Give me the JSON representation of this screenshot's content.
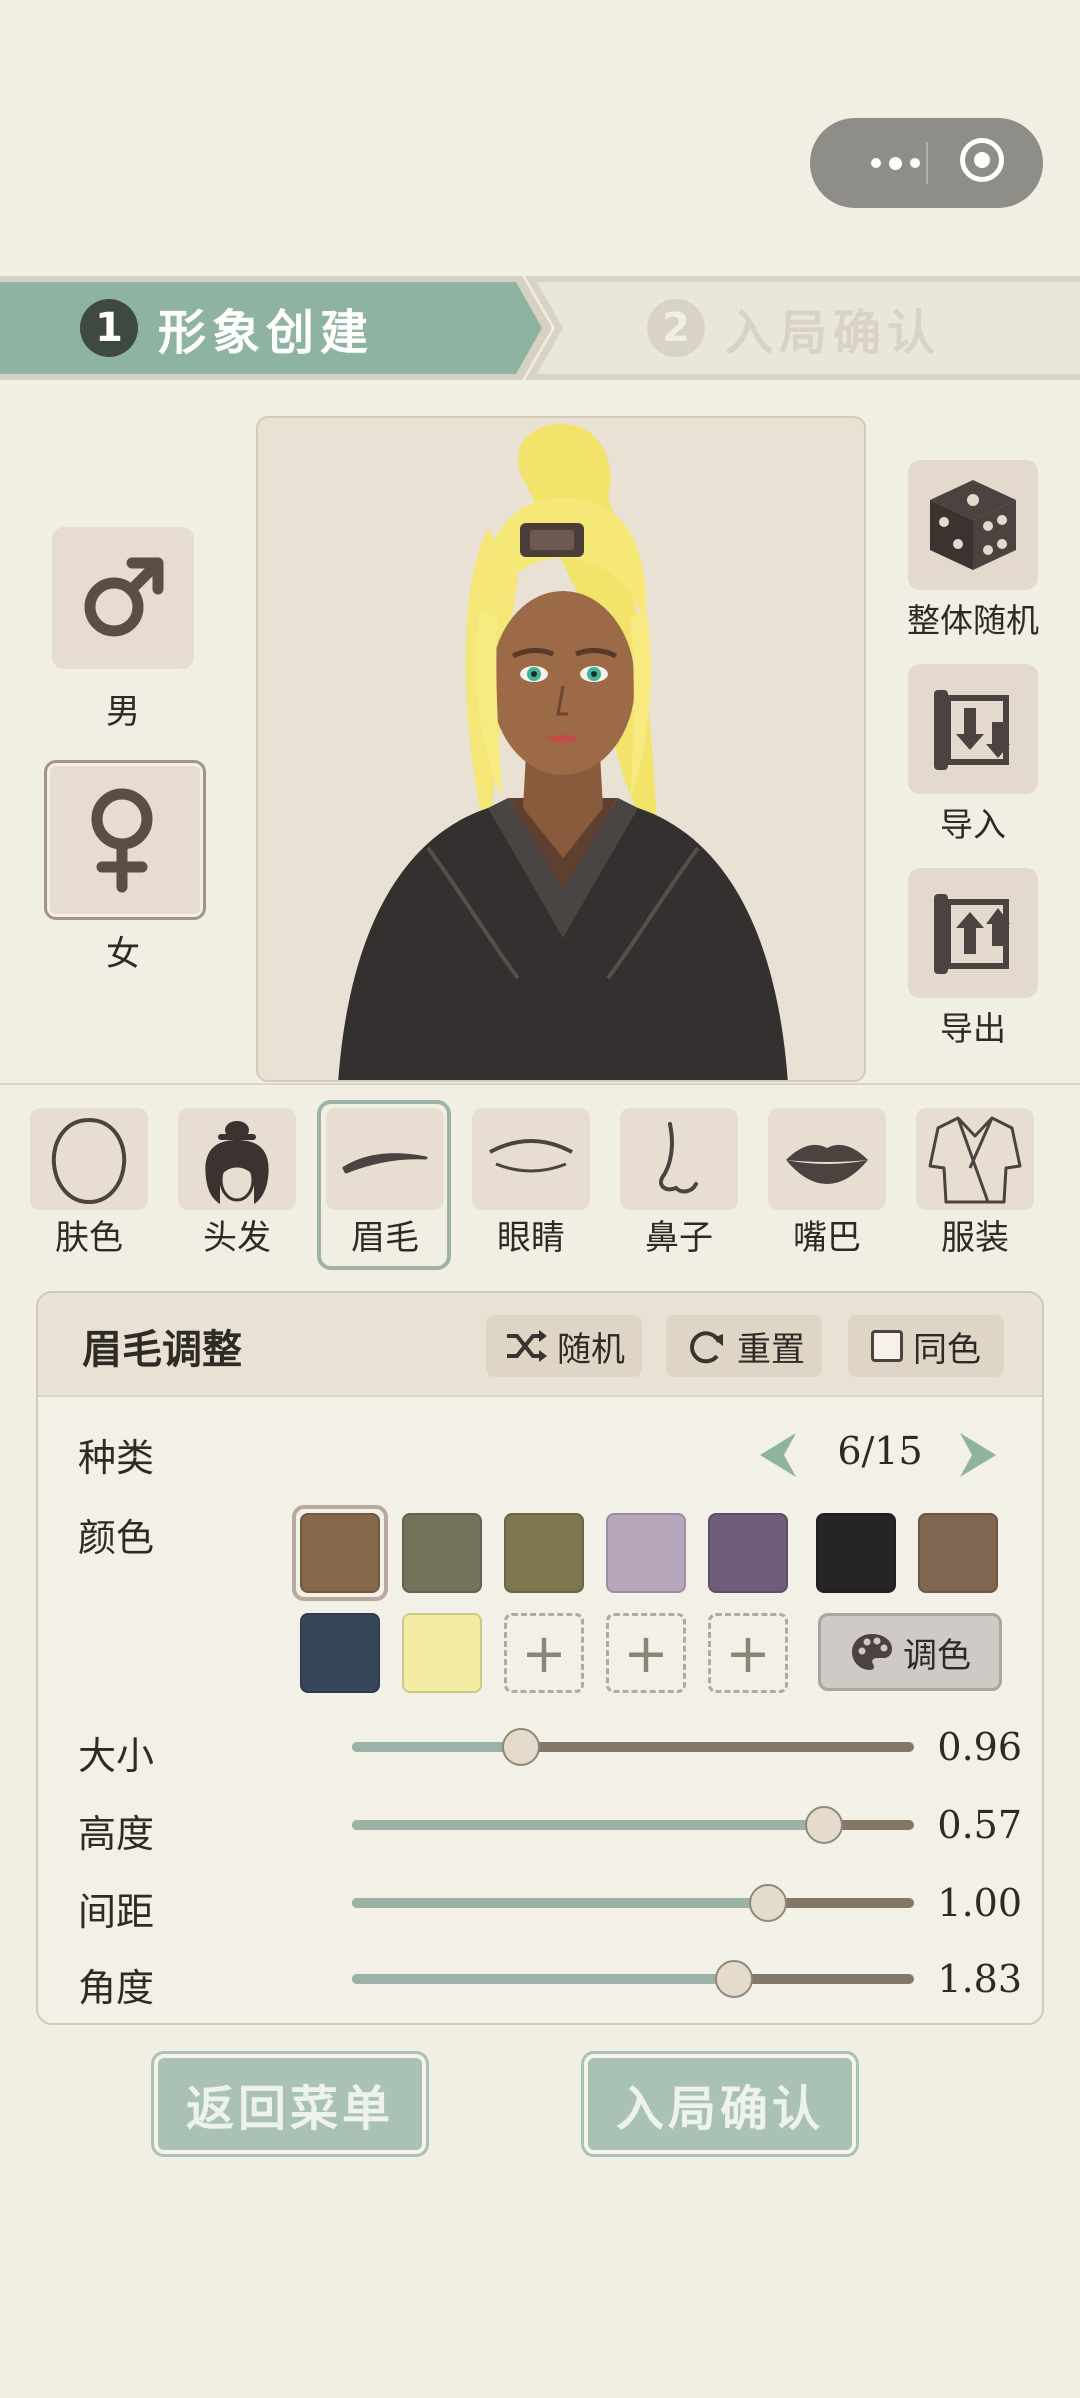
{
  "steps": [
    {
      "num": "1",
      "label": "形象创建",
      "active": true
    },
    {
      "num": "2",
      "label": "入局确认",
      "active": false
    }
  ],
  "gender": {
    "male_label": "男",
    "female_label": "女",
    "selected": "女"
  },
  "actions": {
    "random_all": "整体随机",
    "import": "导入",
    "export": "导出"
  },
  "features": [
    {
      "label": "肤色",
      "icon": "face-outline-icon"
    },
    {
      "label": "头发",
      "icon": "hair-bun-icon"
    },
    {
      "label": "眉毛",
      "icon": "eyebrow-icon",
      "selected": true
    },
    {
      "label": "眼睛",
      "icon": "eye-icon"
    },
    {
      "label": "鼻子",
      "icon": "nose-icon"
    },
    {
      "label": "嘴巴",
      "icon": "lips-icon"
    },
    {
      "label": "服装",
      "icon": "robe-icon"
    }
  ],
  "panel": {
    "title": "眉毛调整",
    "random_btn": "随机",
    "reset_btn": "重置",
    "same_color": "同色",
    "same_color_checked": false,
    "type_label": "种类",
    "type_value": "6/15",
    "color_label": "颜色",
    "swatches": [
      "#86684a",
      "#747259",
      "#7d764f",
      "#b6a7bd",
      "#6f5d79",
      "#262524",
      "#7f6651",
      "#37475a",
      "#f4eba4"
    ],
    "selected_swatch": 0,
    "add_slot": "+",
    "palette_btn": "调色",
    "sliders": [
      {
        "label": "大小",
        "value": "0.96",
        "position": 0.3
      },
      {
        "label": "高度",
        "value": "0.57",
        "position": 0.84
      },
      {
        "label": "间距",
        "value": "1.00",
        "position": 0.74
      },
      {
        "label": "角度",
        "value": "1.83",
        "position": 0.68
      }
    ]
  },
  "bottom": {
    "back": "返回菜单",
    "confirm": "入局确认"
  },
  "colors": {
    "background": "#f1eee4",
    "accent": "#8fb3a1",
    "accent_muted": "#a9c2b5",
    "track_filled": "#9db2a6",
    "track_empty": "#85766a"
  }
}
